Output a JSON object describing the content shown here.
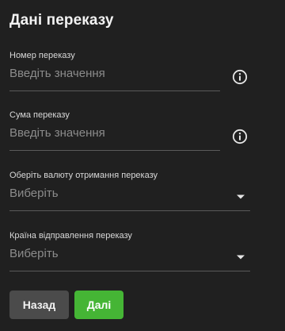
{
  "title": "Дані переказу",
  "fields": {
    "transfer_number": {
      "label": "Номер переказу",
      "placeholder": "Введіть значення",
      "value": "",
      "icon": "info-icon"
    },
    "amount": {
      "label": "Сума переказу",
      "placeholder": "Введіть значення",
      "value": "",
      "icon": "info-icon"
    },
    "currency": {
      "label": "Оберіть валюту отримання переказу",
      "selected": "Виберіть",
      "icon": "chevron-down-icon"
    },
    "country": {
      "label": "Країна відправлення переказу",
      "selected": "Виберіть",
      "icon": "chevron-down-icon"
    }
  },
  "buttons": {
    "back_label": "Назад",
    "next_label": "Далі"
  },
  "colors": {
    "background": "#202020",
    "accent": "#45b535",
    "secondary_button": "#4b4b4b",
    "underline": "#5a5a5a"
  }
}
